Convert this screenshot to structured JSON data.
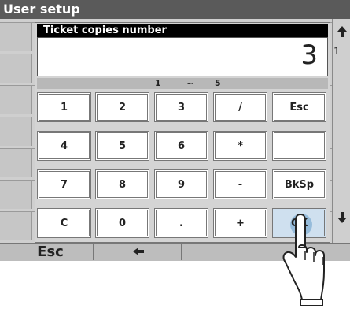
{
  "window": {
    "title": "User setup"
  },
  "keypad": {
    "title": "Ticket copies number",
    "value": "3",
    "range": {
      "min": "1",
      "separator": "~",
      "max": "5"
    },
    "keys": [
      [
        "1",
        "2",
        "3",
        "/",
        "Esc"
      ],
      [
        "4",
        "5",
        "6",
        "*",
        ""
      ],
      [
        "7",
        "8",
        "9",
        "-",
        "BkSp"
      ],
      [
        "C",
        "0",
        ".",
        "+",
        "OK"
      ]
    ]
  },
  "scroll": {
    "up_icon": "arrow-up-icon",
    "down_icon": "arrow-down-icon",
    "page": "1"
  },
  "bottom": {
    "esc_label": "Esc",
    "back_icon": "arrow-left-icon"
  },
  "pointer": {
    "icon": "tap-hand-icon"
  }
}
